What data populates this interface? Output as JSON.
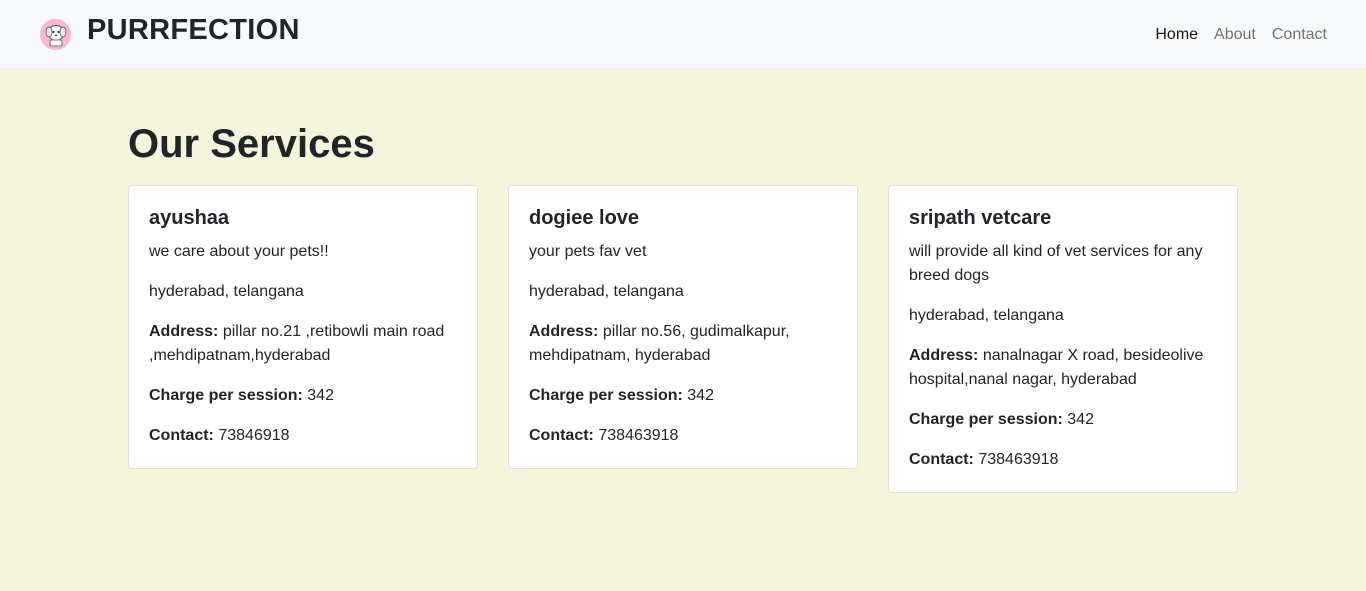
{
  "navbar": {
    "brand": "PURRFECTION",
    "logo_icon": "puppy-logo-icon",
    "links": [
      "Home",
      "About",
      "Contact"
    ],
    "active": "Home"
  },
  "main": {
    "title": "Our Services",
    "labels": {
      "address": "Address:",
      "charge": "Charge per session:",
      "contact": "Contact:"
    },
    "cards": [
      {
        "name": "ayushaa",
        "description": "we care about your pets!!",
        "location": "hyderabad, telangana",
        "address": "pillar no.21 ,retibowli main road ,mehdipatnam,hyderabad",
        "charge": "342",
        "contact": "73846918"
      },
      {
        "name": "dogiee love",
        "description": "your pets fav vet",
        "location": "hyderabad, telangana",
        "address": "pillar no.56, gudimalkapur, mehdipatnam, hyderabad",
        "charge": "342",
        "contact": "738463918"
      },
      {
        "name": "sripath vetcare",
        "description": "will provide all kind of vet services for any breed dogs",
        "location": "hyderabad, telangana",
        "address": "nanalnagar X road, besideolive hospital,nanal nagar, hyderabad",
        "charge": "342",
        "contact": "738463918"
      }
    ]
  }
}
